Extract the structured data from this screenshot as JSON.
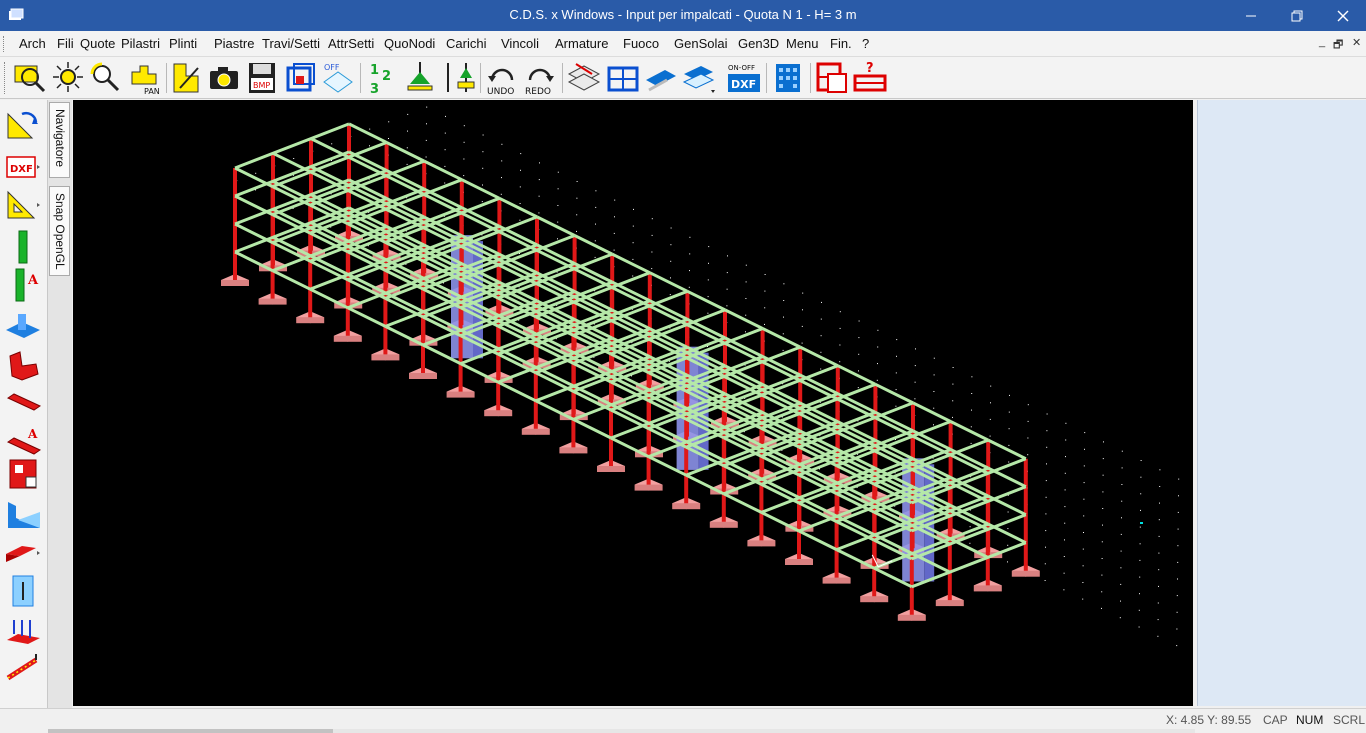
{
  "window": {
    "title": "C.D.S. x Windows - Input per impalcati - Quota N 1 - H= 3 m",
    "controls": {
      "minimize": "minimize-icon",
      "restore": "restore-icon",
      "close": "close-icon"
    }
  },
  "menu": {
    "items": [
      "Arch",
      "Fili",
      "Quote",
      "Pilastri",
      "Plinti",
      "Piastre",
      "Travi/Setti",
      "AttrSetti",
      "QuoNodi",
      "Carichi",
      "Vincoli",
      "Armature",
      "Fuoco",
      "GenSolai",
      "Gen3D",
      "Menu",
      "Fin.",
      "?"
    ],
    "mdi_controls": [
      "_",
      "🗗",
      "✕"
    ]
  },
  "toolbar": {
    "labels": {
      "pan": "PAN",
      "bmp": "BMP",
      "off": "OFF",
      "num1": "1",
      "num2": "2",
      "num3": "3",
      "undo": "UNDO",
      "redo": "REDO",
      "onoff": "ON-OFF",
      "dxf": "DXF",
      "q": "?"
    }
  },
  "left_tools": {
    "dxf_label": "DXF",
    "a_label": "A"
  },
  "side_tabs": [
    "Navigatore",
    "Snap OpenGL"
  ],
  "status": {
    "coords": "X:  4.85  Y: 89.55",
    "indicators": [
      "CAP",
      "NUM",
      "SCRL"
    ]
  },
  "colors": {
    "titlebar": "#2a5ba8",
    "viewport_bg": "#000000",
    "beam": "#b5e8a8",
    "column": "#e01818",
    "footing": "#f2a0a0",
    "core_wall": "#8c92ea",
    "grid_dot": "#ffffff",
    "right_panel": "#dde8f5"
  }
}
